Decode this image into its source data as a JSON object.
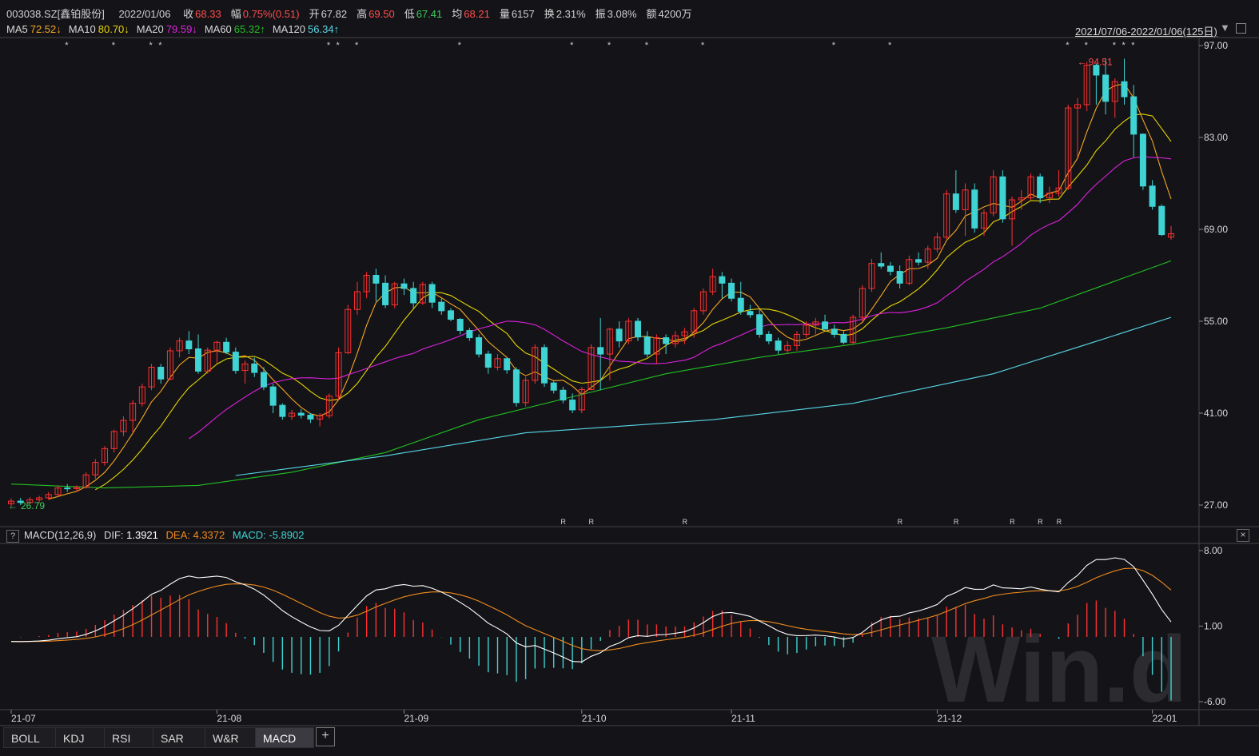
{
  "header": {
    "code": "003038.SZ[鑫铂股份]",
    "date": "2022/01/06",
    "fields": [
      {
        "label": "收",
        "value": "68.33",
        "tone": "up"
      },
      {
        "label": "幅",
        "value": "0.75%(0.51)",
        "tone": "up"
      },
      {
        "label": "开",
        "value": "67.82",
        "tone": "plain"
      },
      {
        "label": "高",
        "value": "69.50",
        "tone": "up"
      },
      {
        "label": "低",
        "value": "67.41",
        "tone": "dn"
      },
      {
        "label": "均",
        "value": "68.21",
        "tone": "up"
      },
      {
        "label": "量",
        "value": "6157",
        "tone": "plain"
      },
      {
        "label": "换",
        "value": "2.31%",
        "tone": "plain"
      },
      {
        "label": "振",
        "value": "3.08%",
        "tone": "plain"
      },
      {
        "label": "额",
        "value": "4200万",
        "tone": "plain"
      }
    ]
  },
  "ma_legend": [
    {
      "label": "MA5",
      "value": "72.52↓",
      "color": "#f5a623"
    },
    {
      "label": "MA10",
      "value": "80.70↓",
      "color": "#e6d400"
    },
    {
      "label": "MA20",
      "value": "79.59↓",
      "color": "#e020e0"
    },
    {
      "label": "MA60",
      "value": "65.32↑",
      "color": "#22c022"
    },
    {
      "label": "MA120",
      "value": "56.34↑",
      "color": "#58d8e8"
    }
  ],
  "range_label": "2021/07/06-2022/01/06(125日)",
  "range_arrow": "▼",
  "price_axis": {
    "ticks": [
      "97.00",
      "83.00",
      "69.00",
      "55.00",
      "41.00",
      "27.00"
    ],
    "min": 27,
    "max": 97
  },
  "annotations": {
    "high_label": "94.51",
    "low_label": "26.79",
    "high_arrow": "←",
    "low_arrow": "←"
  },
  "star_mark": "*",
  "r_mark": "R",
  "macd": {
    "header_icon": "?",
    "title": "MACD(12,26,9)",
    "dif_label": "DIF:",
    "dif_value": "1.3921",
    "dea_label": "DEA:",
    "dea_value": "4.3372",
    "macd_label": "MACD:",
    "macd_value": "-5.8902",
    "close_icon": "×",
    "axis": {
      "ticks": [
        "8.00",
        "1.00",
        "-6.00"
      ],
      "min": -6,
      "max": 8
    }
  },
  "date_axis": [
    "21-07",
    "21-08",
    "21-09",
    "21-10",
    "21-11",
    "21-12",
    "22-01"
  ],
  "tabs": [
    "BOLL",
    "KDJ",
    "RSI",
    "SAR",
    "W&R",
    "MACD"
  ],
  "active_tab": "MACD",
  "tab_plus": "+",
  "watermark": "Win.d",
  "colors": {
    "up": "#ff3030",
    "down": "#3fd3d3",
    "dif": "#ffffff",
    "dea": "#f08a1e",
    "grid": "#2a2a30",
    "axis": "#444"
  },
  "chart_data": {
    "type": "candlestick",
    "x": [
      "21-07",
      "21-08",
      "21-09",
      "21-10",
      "21-11",
      "21-12",
      "22-01"
    ],
    "period_days": 125,
    "ohlc_approx": [
      [
        27.2,
        28.0,
        26.79,
        27.6
      ],
      [
        27.6,
        28.1,
        27.0,
        27.4
      ],
      [
        27.4,
        28.2,
        27.1,
        27.8
      ],
      [
        27.8,
        28.4,
        27.3,
        28.1
      ],
      [
        28.1,
        29.0,
        27.8,
        28.6
      ],
      [
        28.6,
        30.0,
        28.3,
        29.6
      ],
      [
        29.6,
        30.2,
        29.0,
        29.5
      ],
      [
        29.5,
        30.0,
        29.0,
        29.7
      ],
      [
        29.7,
        32.0,
        29.5,
        31.6
      ],
      [
        31.6,
        34.0,
        31.0,
        33.5
      ],
      [
        33.5,
        36.0,
        33.0,
        35.6
      ],
      [
        35.6,
        38.5,
        35.0,
        38.2
      ],
      [
        38.2,
        40.5,
        37.5,
        39.9
      ],
      [
        39.9,
        43.0,
        38.0,
        42.5
      ],
      [
        42.5,
        45.5,
        42.0,
        45.0
      ],
      [
        45.0,
        48.5,
        44.5,
        48.0
      ],
      [
        48.0,
        48.5,
        45.5,
        46.2
      ],
      [
        46.2,
        51.0,
        46.0,
        50.5
      ],
      [
        50.5,
        52.5,
        49.5,
        52.0
      ],
      [
        52.0,
        53.5,
        50.0,
        50.8
      ],
      [
        50.8,
        53.0,
        47.0,
        47.4
      ],
      [
        47.4,
        51.0,
        47.0,
        50.6
      ],
      [
        50.6,
        52.0,
        48.5,
        51.8
      ],
      [
        51.8,
        52.5,
        50.0,
        50.3
      ],
      [
        50.3,
        51.0,
        47.0,
        47.5
      ],
      [
        47.5,
        49.0,
        45.5,
        48.5
      ],
      [
        48.5,
        49.5,
        46.5,
        47.2
      ],
      [
        47.2,
        48.0,
        44.5,
        45.0
      ],
      [
        45.0,
        45.5,
        41.0,
        42.2
      ],
      [
        42.2,
        42.5,
        40.0,
        40.5
      ],
      [
        40.5,
        41.5,
        40.0,
        41.0
      ],
      [
        41.0,
        41.6,
        40.2,
        40.7
      ],
      [
        40.7,
        41.0,
        39.5,
        40.1
      ],
      [
        40.1,
        41.0,
        39.0,
        40.6
      ],
      [
        40.6,
        44.0,
        40.2,
        43.6
      ],
      [
        43.6,
        51.0,
        43.0,
        50.2
      ],
      [
        50.2,
        57.5,
        50.0,
        56.8
      ],
      [
        56.8,
        61.0,
        56.0,
        59.5
      ],
      [
        59.5,
        62.5,
        58.5,
        62.0
      ],
      [
        62.0,
        63.0,
        58.0,
        60.8
      ],
      [
        60.8,
        62.0,
        57.0,
        57.5
      ],
      [
        57.5,
        61.0,
        57.0,
        60.7
      ],
      [
        60.7,
        61.5,
        59.0,
        60.0
      ],
      [
        60.0,
        61.0,
        57.0,
        57.8
      ],
      [
        57.8,
        61.0,
        57.5,
        60.6
      ],
      [
        60.6,
        61.0,
        57.0,
        57.9
      ],
      [
        57.9,
        58.5,
        56.0,
        56.6
      ],
      [
        56.6,
        57.0,
        55.0,
        55.3
      ],
      [
        55.3,
        55.5,
        53.0,
        53.6
      ],
      [
        53.6,
        54.0,
        52.0,
        52.5
      ],
      [
        52.5,
        53.0,
        49.5,
        50.0
      ],
      [
        50.0,
        50.5,
        47.0,
        48.0
      ],
      [
        48.0,
        50.0,
        47.5,
        49.3
      ],
      [
        49.3,
        49.5,
        47.0,
        47.6
      ],
      [
        47.6,
        48.0,
        42.0,
        42.6
      ],
      [
        42.6,
        46.5,
        42.0,
        46.0
      ],
      [
        46.0,
        51.5,
        45.5,
        51.0
      ],
      [
        51.0,
        51.5,
        45.0,
        45.6
      ],
      [
        45.6,
        46.0,
        44.0,
        44.5
      ],
      [
        44.5,
        45.0,
        42.5,
        43.0
      ],
      [
        43.0,
        44.0,
        41.0,
        41.5
      ],
      [
        41.5,
        45.0,
        41.0,
        44.6
      ],
      [
        44.6,
        51.5,
        44.5,
        51.0
      ],
      [
        51.0,
        55.5,
        44.5,
        50.0
      ],
      [
        50.0,
        54.0,
        46.0,
        53.8
      ],
      [
        53.8,
        55.0,
        51.0,
        52.0
      ],
      [
        52.0,
        55.5,
        51.5,
        55.0
      ],
      [
        55.0,
        55.5,
        52.0,
        52.6
      ],
      [
        52.6,
        53.5,
        49.5,
        50.0
      ],
      [
        50.0,
        53.0,
        48.5,
        52.5
      ],
      [
        52.5,
        53.0,
        50.0,
        51.6
      ],
      [
        51.6,
        53.5,
        51.0,
        52.8
      ],
      [
        52.8,
        54.0,
        51.5,
        53.4
      ],
      [
        53.4,
        57.0,
        52.5,
        56.6
      ],
      [
        56.6,
        60.0,
        56.0,
        59.5
      ],
      [
        59.5,
        63.0,
        59.0,
        61.8
      ],
      [
        61.8,
        62.5,
        58.5,
        60.8
      ],
      [
        60.8,
        61.5,
        58.0,
        58.5
      ],
      [
        58.5,
        61.0,
        56.0,
        56.5
      ],
      [
        56.5,
        57.5,
        55.5,
        56.0
      ],
      [
        56.0,
        57.0,
        52.5,
        53.0
      ],
      [
        53.0,
        53.5,
        51.5,
        52.0
      ],
      [
        52.0,
        52.5,
        50.0,
        50.6
      ],
      [
        50.6,
        52.0,
        50.0,
        51.3
      ],
      [
        51.3,
        53.5,
        50.5,
        53.0
      ],
      [
        53.0,
        55.0,
        52.5,
        54.4
      ],
      [
        54.4,
        55.5,
        53.0,
        54.9
      ],
      [
        54.9,
        56.0,
        54.0,
        53.8
      ],
      [
        53.8,
        54.5,
        52.5,
        53.0
      ],
      [
        53.0,
        53.5,
        51.5,
        51.8
      ],
      [
        51.8,
        56.0,
        51.5,
        55.6
      ],
      [
        55.6,
        60.5,
        55.0,
        60.0
      ],
      [
        60.0,
        64.5,
        59.5,
        63.8
      ],
      [
        63.8,
        65.5,
        63.0,
        63.4
      ],
      [
        63.4,
        64.0,
        62.0,
        62.6
      ],
      [
        62.6,
        63.5,
        60.0,
        60.8
      ],
      [
        60.8,
        65.0,
        60.5,
        64.4
      ],
      [
        64.4,
        65.5,
        63.5,
        64.0
      ],
      [
        64.0,
        66.5,
        63.0,
        66.0
      ],
      [
        66.0,
        68.5,
        65.5,
        67.8
      ],
      [
        67.8,
        75.0,
        67.5,
        74.4
      ],
      [
        74.4,
        78.0,
        71.5,
        72.0
      ],
      [
        72.0,
        76.0,
        68.0,
        75.0
      ],
      [
        75.0,
        76.0,
        68.5,
        69.2
      ],
      [
        69.2,
        72.0,
        68.0,
        71.5
      ],
      [
        71.5,
        78.0,
        71.0,
        77.0
      ],
      [
        77.0,
        78.0,
        70.0,
        70.6
      ],
      [
        70.6,
        74.0,
        66.5,
        73.5
      ],
      [
        73.5,
        75.0,
        72.0,
        73.8
      ],
      [
        73.8,
        77.5,
        73.5,
        77.0
      ],
      [
        77.0,
        77.5,
        73.0,
        73.8
      ],
      [
        73.8,
        75.5,
        73.0,
        74.5
      ],
      [
        74.5,
        78.0,
        74.0,
        75.3
      ],
      [
        75.3,
        88.0,
        75.0,
        87.5
      ],
      [
        87.5,
        89.0,
        80.0,
        88.0
      ],
      [
        88.0,
        94.51,
        87.0,
        94.0
      ],
      [
        94.0,
        94.2,
        88.0,
        92.5
      ],
      [
        92.5,
        95.0,
        86.5,
        88.5
      ],
      [
        88.5,
        92.0,
        86.0,
        91.5
      ],
      [
        91.5,
        95.0,
        88.0,
        89.2
      ],
      [
        89.2,
        91.0,
        80.0,
        83.5
      ],
      [
        83.5,
        83.6,
        75.0,
        75.6
      ],
      [
        75.6,
        76.5,
        72.0,
        72.5
      ],
      [
        72.5,
        72.8,
        68.0,
        68.2
      ],
      [
        67.82,
        69.5,
        67.41,
        68.33
      ]
    ],
    "ma": {
      "MA5_last": 72.52,
      "MA10_last": 80.7,
      "MA20_last": 79.59,
      "MA60_last": 65.32,
      "MA120_last": 56.34
    },
    "macd_last": {
      "DIF": 1.3921,
      "DEA": 4.3372,
      "MACD": -5.8902
    },
    "price_ylim": [
      27,
      97
    ],
    "macd_ylim": [
      -6,
      8
    ]
  }
}
